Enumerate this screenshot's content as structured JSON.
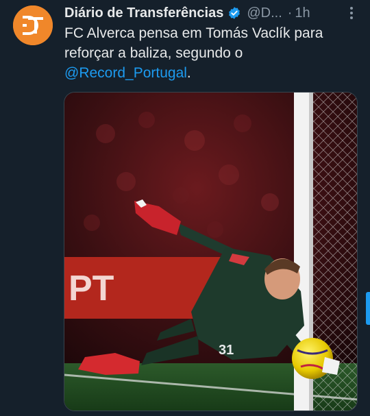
{
  "tweet": {
    "author": {
      "display_name": "Diário de Transferências",
      "handle": "@D...",
      "avatar_initials": "DT",
      "avatar_color": "#f0872a",
      "verified": true
    },
    "separator": "·",
    "time": "1h",
    "text": {
      "line1": "FC Alverca pensa em Tomás Vaclík para",
      "line2": "reforçar a baliza, segundo o",
      "mention": "@Record_Portugal",
      "after_mention": "."
    },
    "media": {
      "kind": "photo",
      "alt": "Goalkeeper in dark green kit diving to save a yellow ball beside the goal post",
      "jersey_number": "31",
      "banner_text": "PT"
    },
    "colors": {
      "background": "#15202b",
      "text": "#e7e9ea",
      "secondary": "#8b98a5",
      "link": "#1d9bf0"
    }
  }
}
